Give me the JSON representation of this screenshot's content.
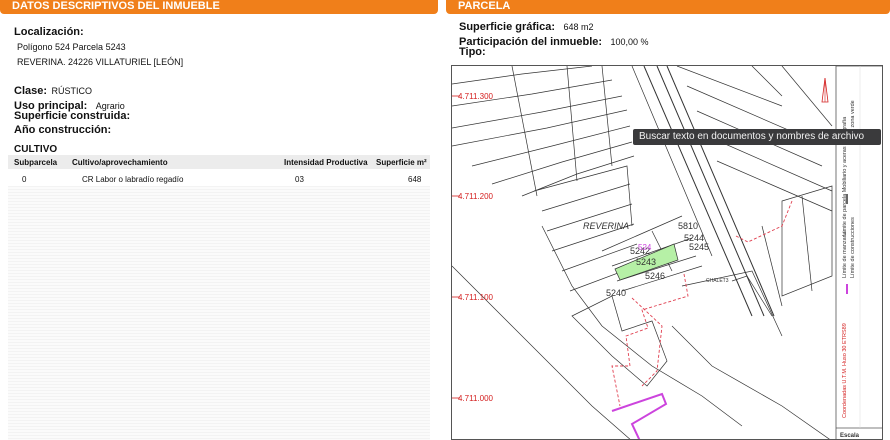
{
  "left": {
    "header": "DATOS DESCRIPTIVOS DEL INMUEBLE",
    "localizacion_label": "Localización:",
    "address_line1": "Polígono 524 Parcela 5243",
    "address_line2": "REVERINA. 24226 VILLATURIEL [LEÓN]",
    "clase_label": "Clase:",
    "clase_value": "RÚSTICO",
    "uso_label": "Uso principal:",
    "uso_value": "Agrario",
    "superficie_construida_label": "Superficie construida:",
    "anio_label": "Año construcción:",
    "cultivo_title": "CULTIVO",
    "table": {
      "headers": [
        "Subparcela",
        "Cultivo/aprovechamiento",
        "Intensidad Productiva",
        "Superficie m²"
      ],
      "rows": [
        [
          "0",
          "CR Labor o labradío regadío",
          "03",
          "648"
        ]
      ]
    }
  },
  "right": {
    "header": "PARCELA",
    "superficie_label": "Superficie gráfica:",
    "superficie_value": "648 m2",
    "participacion_label": "Participación del inmueble:",
    "participacion_value": "100,00 %",
    "tipo_label": "Tipo:"
  },
  "map": {
    "y_coords": [
      "4.711.300",
      "4.711.200",
      "4.711.100",
      "4.711.000"
    ],
    "place_name": "REVERINA",
    "parcel_numbers": [
      "5810",
      "5244",
      "5245",
      "5242",
      "5243",
      "5246",
      "5240"
    ],
    "overlay_number": "524",
    "chalet_label": "CHALET3",
    "legend": {
      "hidrografia": "Hidrografía",
      "zona_verde": "Límite zona verde",
      "parcela_mobiliario": "Límite de parcela Mobiliario y aceras",
      "manzana": "Límite de manzana",
      "construcciones": "Límite de construcciones",
      "coordenadas": "Coordenadas U.T.M. Huso 30 ETRS89",
      "escala": "Escala"
    },
    "colors": {
      "coord": "#d42020",
      "highlight": "#b6f0a6",
      "overlay": "#cc44dd",
      "dashed": "#e04050"
    }
  },
  "tooltip": {
    "text": "Buscar texto en documentos y nombres de archivo"
  },
  "colors": {
    "header_orange": "#f07f1a"
  }
}
